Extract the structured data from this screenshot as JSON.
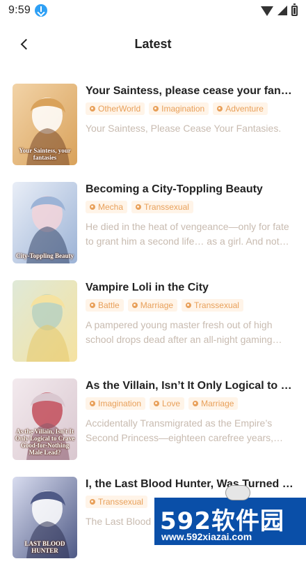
{
  "status_bar": {
    "time": "9:59"
  },
  "header": {
    "title": "Latest"
  },
  "books": [
    {
      "title": "Your Saintess, please cease your fantasies",
      "tags": [
        "OtherWorld",
        "Imagination",
        "Adventure"
      ],
      "description": "Your Saintess, Please Cease Your Fantasies.",
      "cover_text": "Your Saintess, your fantasies",
      "palette": [
        "#d9a25b",
        "#f2d3a7",
        "#7a4a2c",
        "#ffffff"
      ]
    },
    {
      "title": "Becoming a City-Toppling Beauty",
      "tags": [
        "Mecha",
        "Transsexual"
      ],
      "description": "He died in the heat of vengeance—only for fate to grant him a second life… as a girl. And not just any girl…",
      "cover_text": "City-Toppling Beauty",
      "palette": [
        "#9cb3d6",
        "#e9eef7",
        "#39496b",
        "#f2d4d9"
      ]
    },
    {
      "title": "Vampire Loli in the City",
      "tags": [
        "Battle",
        "Marriage",
        "Transsexual"
      ],
      "description": "A pampered young master fresh out of high school drops dead after an all-night gaming binge…",
      "cover_text": "",
      "palette": [
        "#f5e2a0",
        "#dfe9d8",
        "#e6c86a",
        "#b9d1c0"
      ]
    },
    {
      "title": "As the Villain, Isn’t It Only Logical to Crave Good-for-Nothing Male Leads?",
      "tags": [
        "Imagination",
        "Love",
        "Marriage"
      ],
      "description": "Accidentally Transmigrated as the Empire’s Second Princess—eighteen carefree years, until…",
      "cover_text": "As the Villain, Isn't It Only Logical to Crave Good-for-Nothing Male Lead?",
      "palette": [
        "#d9c7cf",
        "#f3eaee",
        "#8a5a6b",
        "#c24d5a"
      ]
    },
    {
      "title": "I, the Last Blood Hunter, Was Turned into a Vampire Girl",
      "tags": [
        "Transsexual"
      ],
      "description": "The Last Blood Hunter…",
      "cover_text": "LAST BLOOD HUNTER",
      "palette": [
        "#4f5a86",
        "#d8dcef",
        "#2d3153",
        "#ffffff"
      ]
    }
  ],
  "watermark": {
    "main": "592软件园",
    "url": "www.592xiazai.com"
  }
}
